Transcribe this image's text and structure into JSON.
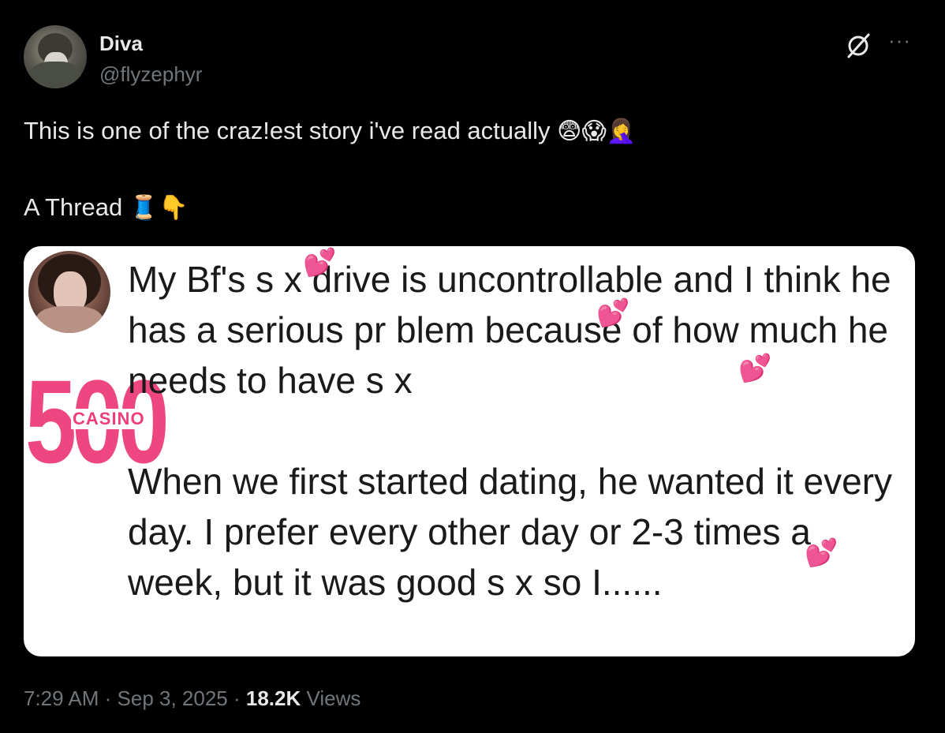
{
  "author": {
    "name": "Diva",
    "handle": "@flyzephyr",
    "avatar_icon": "profile-photo"
  },
  "header_icons": {
    "grok": "grok-icon",
    "more": "···"
  },
  "tweet": {
    "line1": "This is one of the craz!est story i've read actually",
    "line1_emojis": "😨😱🤦‍♀️",
    "line2": "A Thread",
    "line2_emojis": "🧵👇"
  },
  "card": {
    "paragraph1": "My Bf's s x drive is uncontrollable and I think he has a serious pr blem because of how much he needs to have s x",
    "paragraph2": "When we first started dating, he wanted it every day. I prefer every other day or 2-3 times a week, but it was good s x so I......",
    "heart_glyph": "💕",
    "watermark_number": "500",
    "watermark_label": "CASINO",
    "watermark_color": "#ee3d7a"
  },
  "meta": {
    "time": "7:29 AM",
    "sep1": " · ",
    "date": "Sep 3, 2025",
    "sep2": " · ",
    "views_count": "18.2K",
    "views_label": " Views"
  }
}
